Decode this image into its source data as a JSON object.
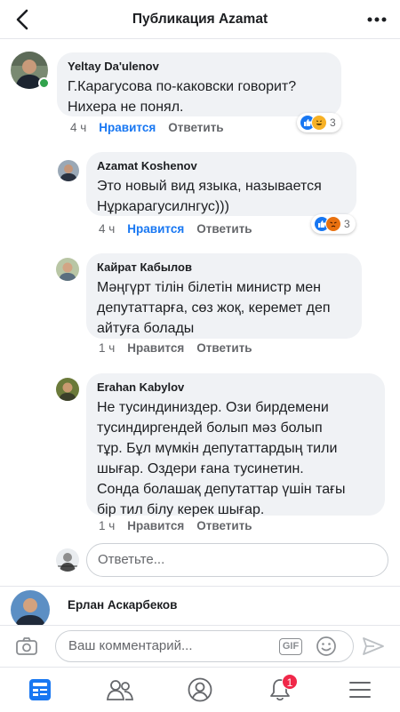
{
  "header": {
    "title": "Публикация Azamat",
    "back_icon": "chevron-left-icon",
    "more_icon": "more-icon"
  },
  "comments": [
    {
      "author": "Yeltay Da'ulenov",
      "lines": [
        "Г.Карагусова по-каковски говорит?",
        "Нихера не понял."
      ],
      "time": "4 ч",
      "like": "Нравится",
      "reply": "Ответить",
      "reactions": [
        "like",
        "haha"
      ],
      "reaction_count": "3",
      "online": true
    },
    {
      "author": "Azamat Koshenov",
      "lines": [
        "Это новый вид языка, называется",
        "Нұркарагусилнгус)))"
      ],
      "time": "4 ч",
      "like": "Нравится",
      "reply": "Ответить",
      "reactions": [
        "like",
        "angry"
      ],
      "reaction_count": "3"
    },
    {
      "author": "Кайрат Кабылов",
      "lines": [
        "Мәңгүрт тілін білетін министр мен",
        "депутаттарға, сөз жоқ, керемет деп",
        "айтуға болады"
      ],
      "time": "1 ч",
      "like": "Нравится",
      "reply": "Ответить"
    },
    {
      "author": "Erahan Kabylov",
      "lines": [
        "Не тусиндиниздер. Ози бирдемени",
        "тусиндиргендей болып мәз болып",
        "тұр. Бұл мүмкін депутаттардың тили",
        "шығар. Оздери ғана тусинетин.",
        "Сонда болашақ депутаттар үшін тағы",
        "бір тил білу керек шығар."
      ],
      "time": "1 ч",
      "like": "Нравится",
      "reply": "Ответить"
    }
  ],
  "reply_input": {
    "placeholder": "Ответьте..."
  },
  "next_comment": {
    "author": "Ерлан Аскарбеков"
  },
  "composer": {
    "placeholder": "Ваш комментарий...",
    "gif_label": "GIF",
    "camera_icon": "camera-icon",
    "emoji_icon": "emoji-icon",
    "send_icon": "send-icon"
  },
  "tabbar": {
    "tabs": [
      {
        "icon": "news-feed-icon",
        "active": true
      },
      {
        "icon": "friends-icon"
      },
      {
        "icon": "profile-icon"
      },
      {
        "icon": "notifications-icon",
        "badge": "1"
      },
      {
        "icon": "menu-icon"
      }
    ]
  },
  "colors": {
    "accent": "#1877f2",
    "bubble": "#f0f2f5",
    "badge": "#f02849",
    "online": "#31a24c",
    "angry": "#e9710f",
    "haha": "#f7b125"
  }
}
